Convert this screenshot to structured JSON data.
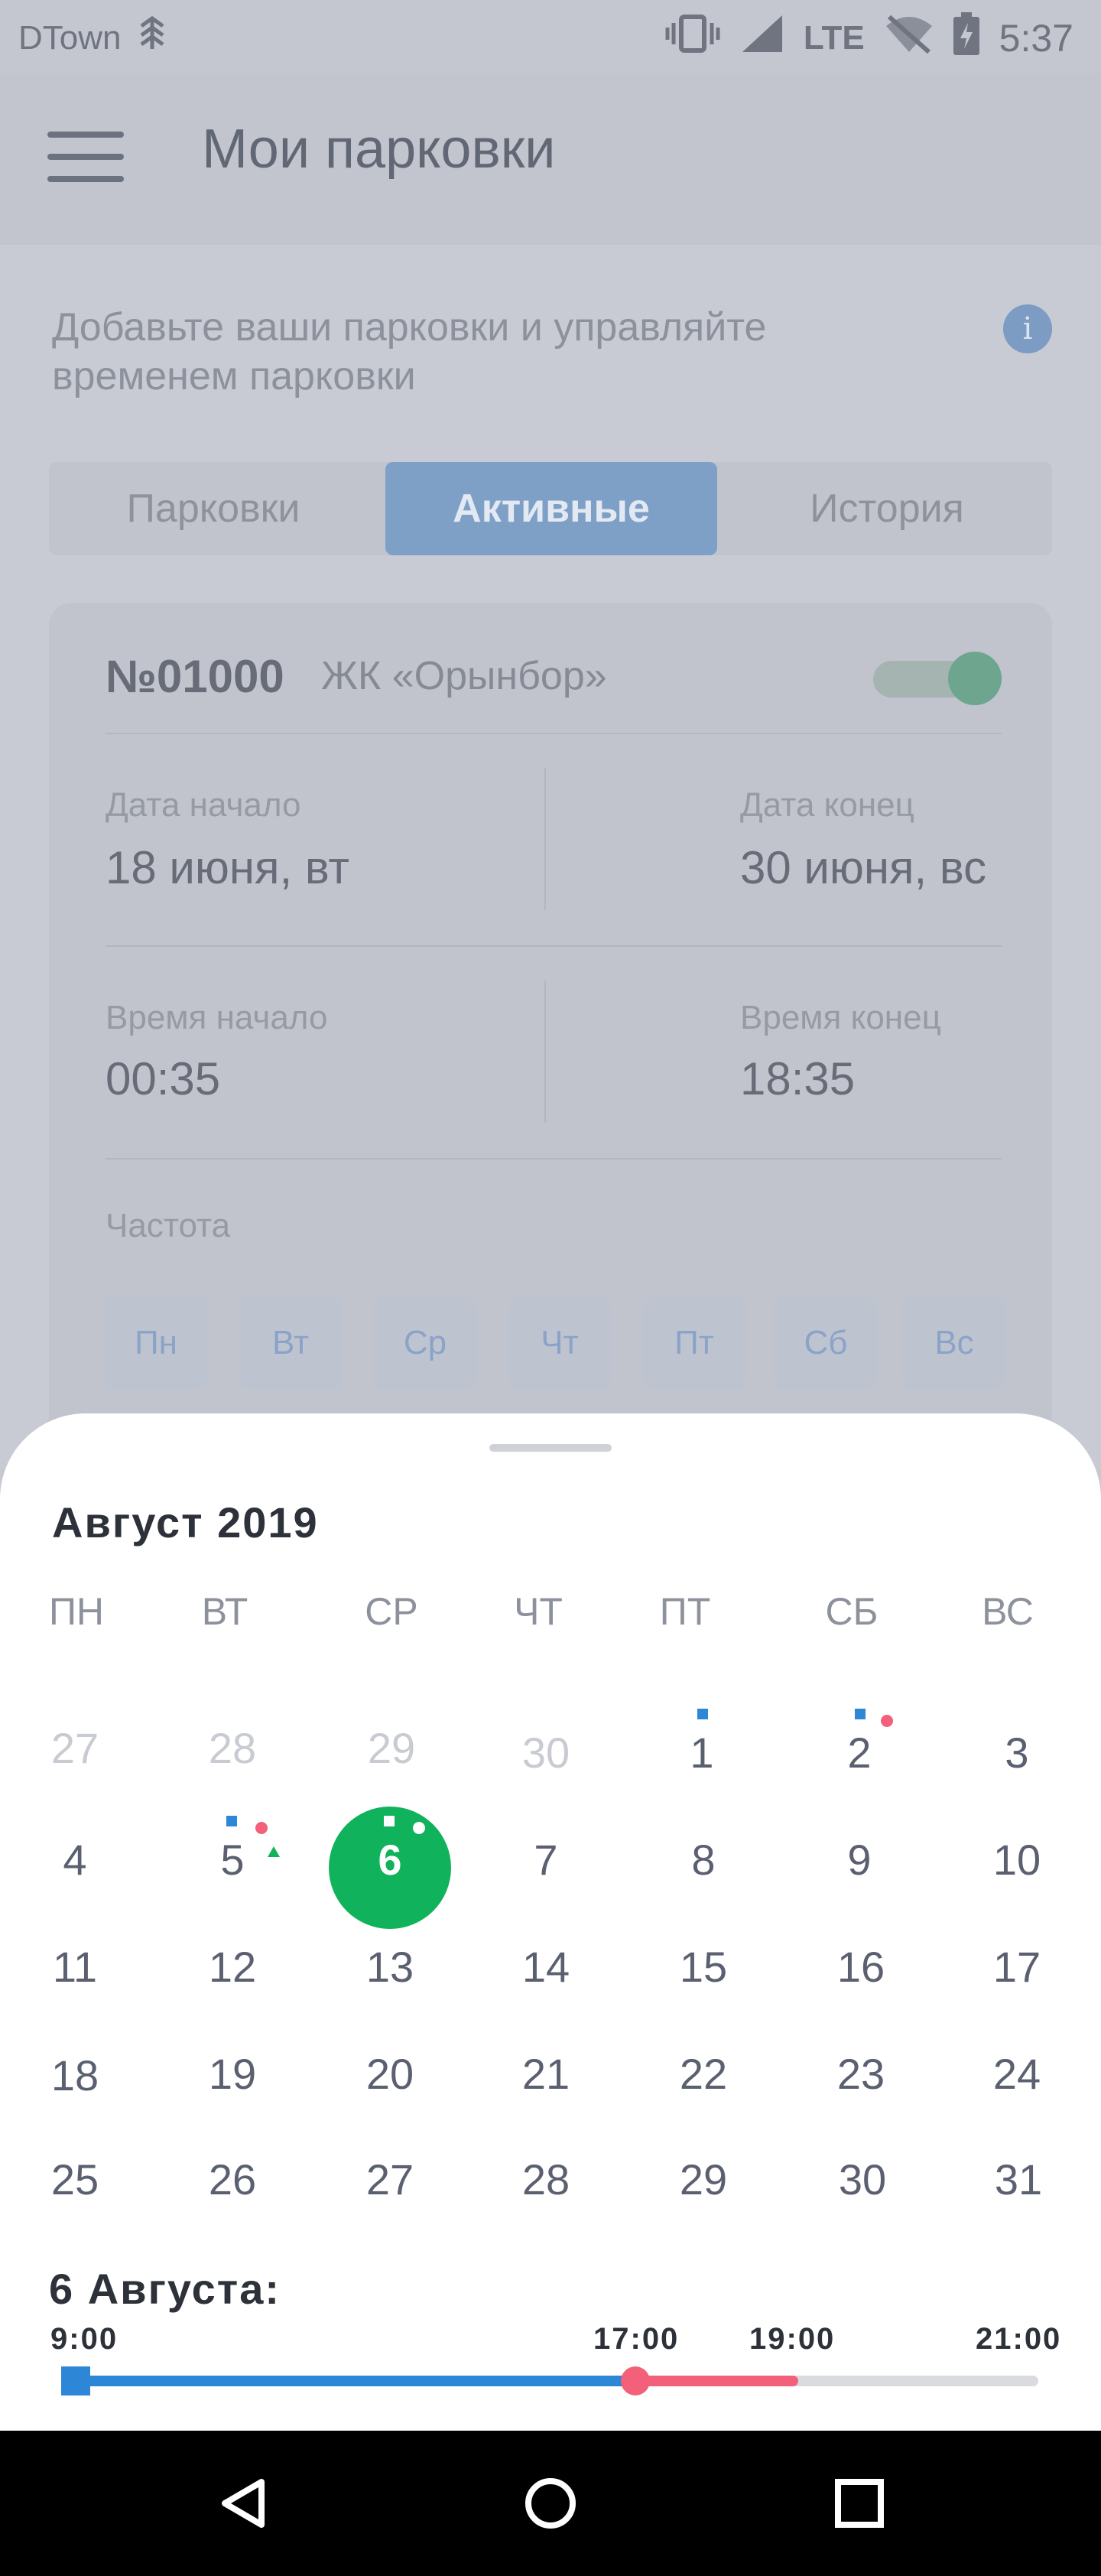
{
  "status_bar": {
    "carrier": "DTown",
    "network": "LTE",
    "time": "5:37"
  },
  "app_bar": {
    "title": "Мои парковки",
    "menu_icon": "menu-icon"
  },
  "intro_text": "Добавьте ваши парковки и управляйте временем парковки",
  "tabs": [
    {
      "label": "Парковки"
    },
    {
      "label": "Активные"
    },
    {
      "label": "История"
    }
  ],
  "active_tab": "Активные",
  "card": {
    "number": "№01000",
    "name": "ЖК «Орынбор»",
    "toggle_on": true,
    "start_date_label": "Дата начало",
    "start_date": "18 июня, вт",
    "end_date_label": "Дата конец",
    "end_date": "30 июня, вс",
    "start_time_label": "Время начало",
    "start_time": "00:35",
    "end_time_label": "Время конец",
    "end_time": "18:35",
    "frequency_label": "Частота",
    "days": [
      "Пн",
      "Вт",
      "Ср",
      "Чт",
      "Пт",
      "Сб",
      "Вс"
    ]
  },
  "calendar": {
    "month_title": "Август 2019",
    "weekdays": [
      "ПН",
      "ВТ",
      "СР",
      "ЧТ",
      "ПТ",
      "СБ",
      "ВС"
    ],
    "rows": [
      [
        "27",
        "28",
        "29",
        "30",
        "1",
        "2",
        "3"
      ],
      [
        "4",
        "5",
        "6",
        "7",
        "8",
        "9",
        "10"
      ],
      [
        "11",
        "12",
        "13",
        "14",
        "15",
        "16",
        "17"
      ],
      [
        "18",
        "19",
        "20",
        "21",
        "22",
        "23",
        "24"
      ],
      [
        "25",
        "26",
        "27",
        "28",
        "29",
        "30",
        "31"
      ]
    ],
    "selected_day": "6"
  },
  "timeline": {
    "date_title": "6 Августа:",
    "labels": [
      "9:00",
      "17:00",
      "19:00",
      "21:00"
    ]
  },
  "colors": {
    "accent_blue": "#2d86d6",
    "accent_green": "#10b35b",
    "accent_pink": "#f2607a"
  },
  "nav": {
    "back_icon": "back-icon",
    "home_icon": "home-icon",
    "recents_icon": "recents-icon"
  }
}
